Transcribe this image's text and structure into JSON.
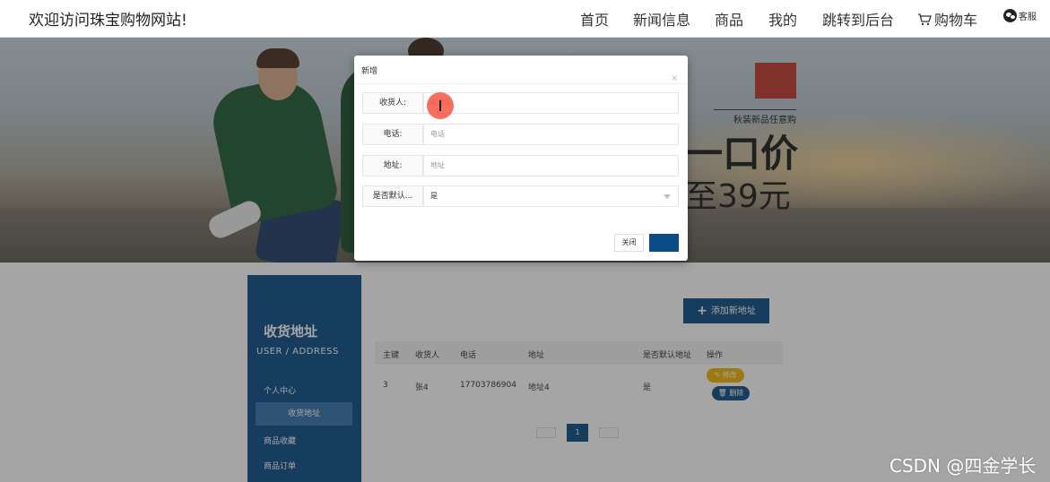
{
  "header": {
    "site_title": "欢迎访问珠宝购物网站!",
    "nav": {
      "home": "首页",
      "news": "新闻信息",
      "products": "商品",
      "mine": "我的",
      "admin": "跳转到后台",
      "cart": "购物车"
    },
    "service": "客服"
  },
  "banner": {
    "brand_sub": "秋装新品任意购",
    "slogan_1": "一口价",
    "slogan_2": "至39元"
  },
  "sidebar": {
    "title": "收货地址",
    "subtitle": "USER / ADDRESS",
    "items": [
      "个人中心",
      "收货地址",
      "商品收藏",
      "商品订单"
    ],
    "active_index": 1
  },
  "main": {
    "add_button": "添加新地址",
    "table": {
      "columns": [
        "主键",
        "收货人",
        "电话",
        "地址",
        "是否默认地址",
        "操作"
      ],
      "rows": [
        {
          "id": "3",
          "receiver": "张4",
          "phone": "17703786904",
          "address": "地址4",
          "is_default": "是"
        }
      ],
      "edit_label": "修改",
      "delete_label": "删除"
    },
    "pagination": {
      "current_page": "1"
    }
  },
  "modal": {
    "title": "新增",
    "fields": [
      {
        "label": "收货人:",
        "placeholder": "收货人"
      },
      {
        "label": "电话:",
        "placeholder": "电话"
      },
      {
        "label": "地址:",
        "placeholder": "地址"
      },
      {
        "label": "是否默认...",
        "value": "是"
      }
    ],
    "close_icon": "×",
    "cancel_label": "关闭"
  },
  "watermark": "CSDN @四金学长",
  "colors": {
    "primary": "#0c4c86",
    "sidebar_active": "#3472aa",
    "edit": "#f1b300",
    "cursor": "#f5503c"
  }
}
